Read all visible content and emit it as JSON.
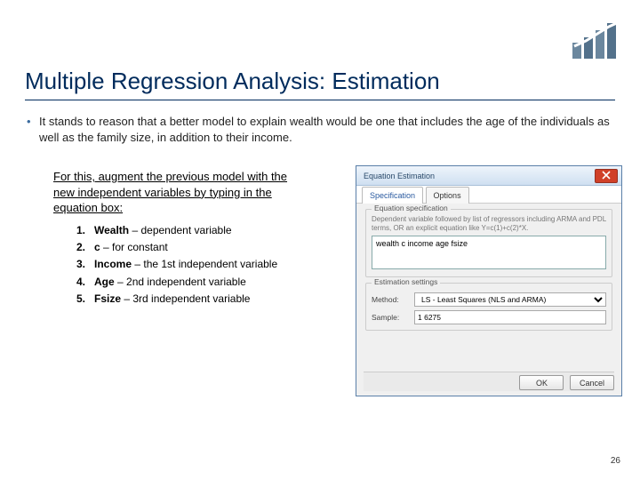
{
  "title": "Multiple Regression Analysis: Estimation",
  "bullet": "It stands to reason that a better model to explain wealth would be one that includes the age of the individuals as well as the family size, in addition to their income.",
  "instruction": "For this, augment the previous model with the new independent variables by typing in the equation box:",
  "items": [
    {
      "num": "1.",
      "term": "Wealth",
      "desc": " – dependent variable"
    },
    {
      "num": "2.",
      "term": "c",
      "desc": " – for constant"
    },
    {
      "num": "3.",
      "term": "Income",
      "desc": " – the 1st independent variable"
    },
    {
      "num": "4.",
      "term": "Age",
      "desc": " – 2nd independent variable"
    },
    {
      "num": "5.",
      "term": "Fsize",
      "desc": " – 3rd independent variable"
    }
  ],
  "dialog": {
    "title": "Equation Estimation",
    "tabs": {
      "spec": "Specification",
      "opt": "Options"
    },
    "group1": "Equation specification",
    "hint": "Dependent variable followed by list of regressors including ARMA and PDL terms, OR an explicit equation like Y=c(1)+c(2)*X.",
    "equation": "wealth c income age fsize",
    "group2": "Estimation settings",
    "method_label": "Method:",
    "method_value": "LS - Least Squares (NLS and ARMA)",
    "sample_label": "Sample:",
    "sample_value": "1 6275",
    "ok": "OK",
    "cancel": "Cancel"
  },
  "page": "26"
}
